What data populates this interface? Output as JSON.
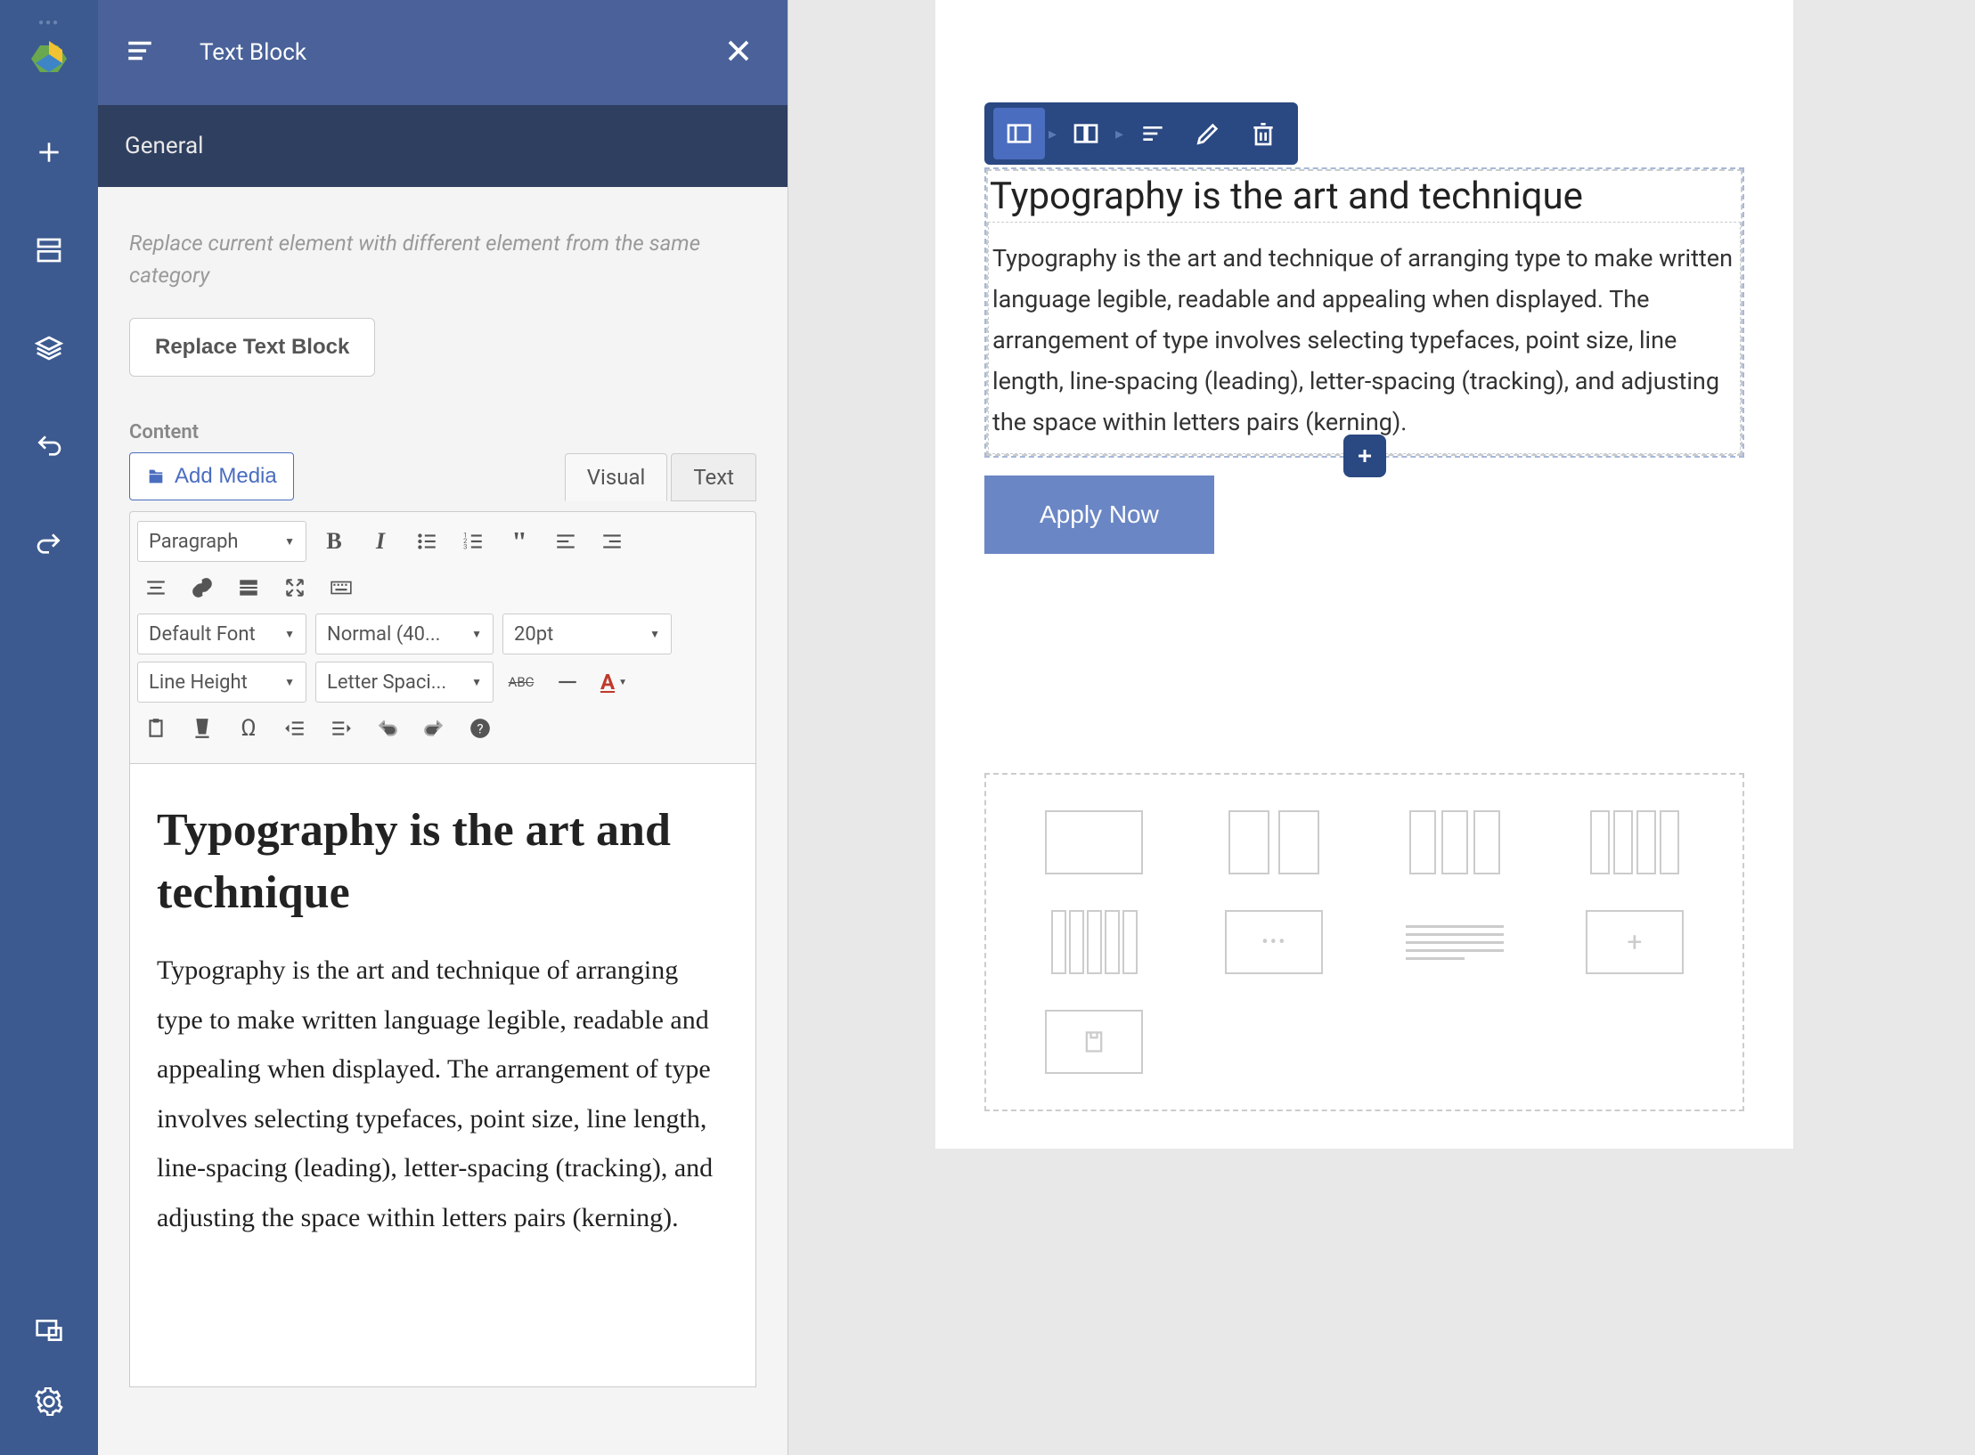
{
  "panel": {
    "title": "Text Block",
    "tab_general": "General",
    "hint": "Replace current element with different element from the same category",
    "replace_button": "Replace Text Block",
    "content_label": "Content",
    "add_media": "Add Media",
    "editor_tabs": {
      "visual": "Visual",
      "text": "Text"
    },
    "toolbar": {
      "paragraph": "Paragraph",
      "font": "Default Font",
      "weight": "Normal (40...",
      "size": "20pt",
      "lineheight": "Line Height",
      "letterspacing": "Letter Spaci...",
      "strike": "ABC"
    },
    "editor": {
      "heading": "Typography is the art and technique",
      "paragraph": "Typography is the art and technique of arranging type to make written language legible, readable and appealing when displayed. The arrangement of type involves selecting typefaces, point size, line length, line-spacing (leading), letter-spacing (tracking), and adjusting the space within letters pairs (kerning)."
    }
  },
  "canvas": {
    "heading": "Typography is the art and technique",
    "paragraph": "Typography is the art and technique of arranging type to make written language legible, readable and appealing when displayed. The arrangement of type involves selecting typefaces, point size, line length, line-spacing (leading), letter-spacing (tracking), and adjusting the space within letters pairs (kerning).",
    "apply_button": "Apply Now"
  }
}
